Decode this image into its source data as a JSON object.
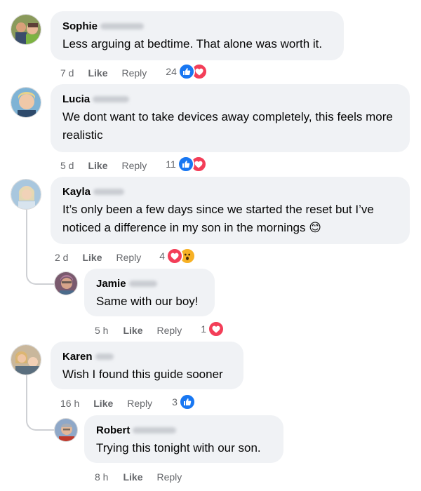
{
  "comments": [
    {
      "name": "Sophie",
      "text": "Less arguing at bedtime. That alone was worth it.",
      "time": "7 d",
      "like": "Like",
      "reply": "Reply",
      "reactions": "24",
      "reaction_types": [
        "like-icon",
        "love-icon"
      ]
    },
    {
      "name": "Lucia",
      "text": "We dont want to take devices away completely, this feels more realistic",
      "time": "5 d",
      "like": "Like",
      "reply": "Reply",
      "reactions": "11",
      "reaction_types": [
        "like-icon",
        "love-icon"
      ]
    },
    {
      "name": "Kayla",
      "text": "It’s only been a few days since we started the reset but I’ve noticed a difference in my son in the mornings 😊",
      "time": "2 d",
      "like": "Like",
      "reply": "Reply",
      "reactions": "4",
      "reaction_types": [
        "love-icon",
        "wow-icon"
      ]
    },
    {
      "name": "Jamie",
      "text": "Same with our boy!",
      "time": "5 h",
      "like": "Like",
      "reply": "Reply",
      "reactions": "1",
      "reaction_types": [
        "love-icon"
      ]
    },
    {
      "name": "Karen",
      "text": "Wish I found this guide sooner",
      "time": "16 h",
      "like": "Like",
      "reply": "Reply",
      "reactions": "3",
      "reaction_types": [
        "like-icon"
      ]
    },
    {
      "name": "Robert",
      "text": "Trying this tonight with our son.",
      "time": "8 h",
      "like": "Like",
      "reply": "Reply",
      "reactions": "",
      "reaction_types": []
    }
  ],
  "colors": {
    "like": "#1877f2",
    "love": "#f33e58",
    "wow": "#f7b125",
    "bubble": "#f0f2f5",
    "meta": "#65676b"
  }
}
